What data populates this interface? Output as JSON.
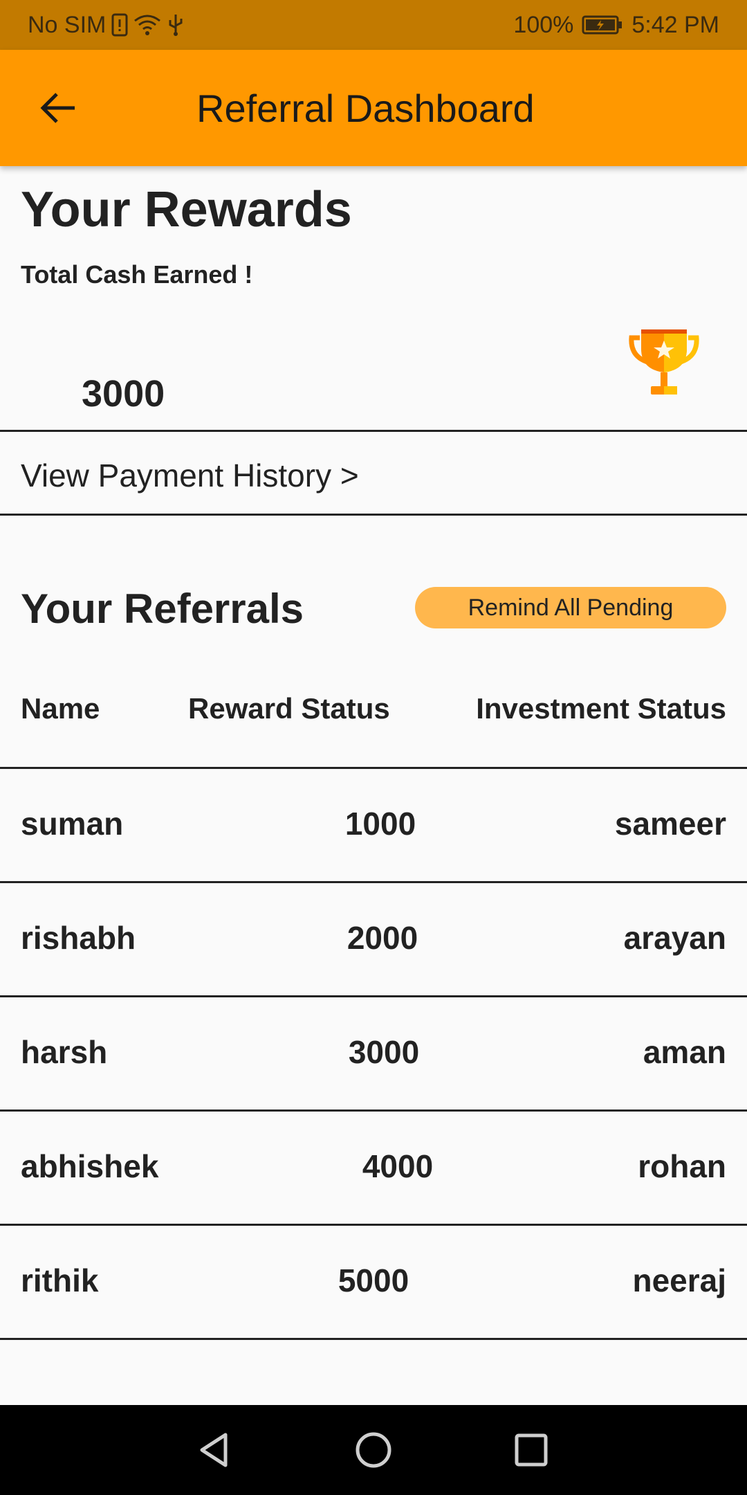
{
  "status_bar": {
    "carrier": "No SIM",
    "battery": "100%",
    "time": "5:42 PM"
  },
  "app_bar": {
    "title": "Referral Dashboard",
    "back_icon": "arrow-back-icon"
  },
  "rewards": {
    "title": "Your Rewards",
    "subtitle": "Total Cash Earned !",
    "total": "3000",
    "trophy_icon": "trophy-icon",
    "payment_history_link": "View Payment History >"
  },
  "referrals": {
    "title": "Your Referrals",
    "remind_button": "Remind All Pending",
    "columns": {
      "name": "Name",
      "reward": "Reward Status",
      "investment": "Investment Status"
    },
    "rows": [
      {
        "name": "suman",
        "reward": "1000",
        "investment": "sameer"
      },
      {
        "name": "rishabh",
        "reward": "2000",
        "investment": "arayan"
      },
      {
        "name": "harsh",
        "reward": "3000",
        "investment": "aman"
      },
      {
        "name": "abhishek",
        "reward": "4000",
        "investment": "rohan"
      },
      {
        "name": "rithik",
        "reward": "5000",
        "investment": "neeraj"
      }
    ]
  },
  "colors": {
    "status_bar": "#c27a00",
    "app_bar": "#ff9800",
    "remind_button": "#ffb74d",
    "trophy_gold": "#ffc107",
    "trophy_orange": "#ff8f00"
  }
}
